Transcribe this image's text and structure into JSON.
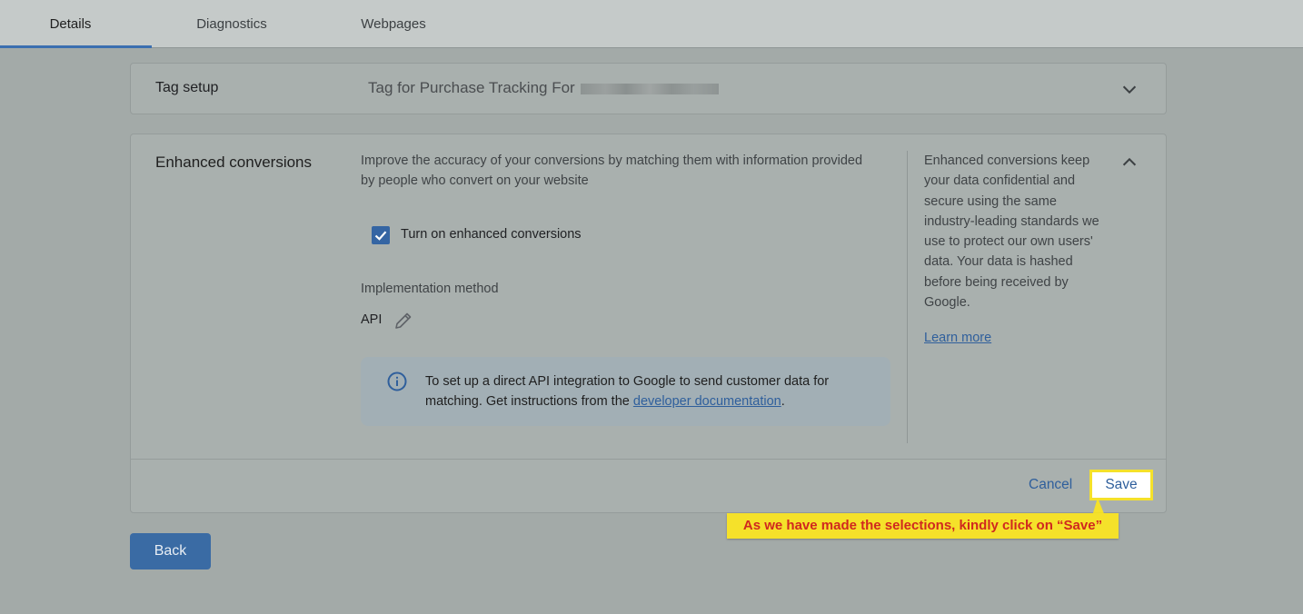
{
  "tabs": [
    {
      "label": "Details",
      "active": true
    },
    {
      "label": "Diagnostics",
      "active": false
    },
    {
      "label": "Webpages",
      "active": false
    }
  ],
  "tag_setup": {
    "label": "Tag setup",
    "value": "Tag for Purchase Tracking For",
    "icon": "chevron-down-icon"
  },
  "enhanced": {
    "title": "Enhanced conversions",
    "description": "Improve the accuracy of your conversions by matching them with information provided by people who convert on your website",
    "checkbox_label": "Turn on enhanced conversions",
    "checkbox_checked": true,
    "impl_label": "Implementation method",
    "impl_value": "API",
    "info_text": "To set up a direct API integration to Google to send customer data for matching. Get instructions from the",
    "info_link": "developer documentation",
    "info_end": ".",
    "side_text": "Enhanced conversions keep your data confidential and secure using the same industry-leading standards we use to protect our own users' data. Your data is hashed before being received by Google.",
    "side_link": "Learn more",
    "icon": "chevron-up-icon"
  },
  "actions": {
    "cancel": "Cancel",
    "save": "Save"
  },
  "back_label": "Back",
  "callout": "As we have made the selections, kindly click on “Save”",
  "colors": {
    "accent": "#3b6fb0",
    "highlight": "#f5e12a",
    "callout_text": "#d0281f"
  }
}
